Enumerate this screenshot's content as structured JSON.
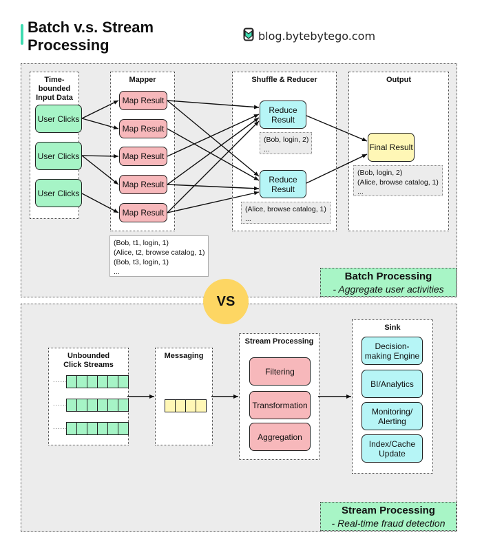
{
  "header": {
    "title_line1": "Batch v.s. Stream",
    "title_line2": "Processing",
    "accent_color": "#3ddbb0",
    "brand_icon": "bytebytego-logo-icon",
    "brand_text": "blog.bytebytego.com"
  },
  "batch": {
    "groups": {
      "input": "Time-bounded\nInput Data",
      "mapper": "Mapper",
      "reducer": "Shuffle & Reducer",
      "output": "Output"
    },
    "inputs": [
      "User Clicks",
      "User Clicks",
      "User Clicks"
    ],
    "map_results": [
      "Map Result",
      "Map Result",
      "Map Result",
      "Map Result",
      "Map Result"
    ],
    "reduce_results": [
      "Reduce\nResult",
      "Reduce\nResult"
    ],
    "final_result": "Final Result",
    "mapper_note": "(Bob, t1, login, 1)\n(Alice, t2, browse catalog, 1)\n(Bob, t3, login, 1)\n...",
    "reduce_note_1": "(Bob, login, 2)\n...",
    "reduce_note_2": "(Alice, browse catalog, 1)\n...",
    "output_note": "(Bob, login, 2)\n(Alice, browse catalog, 1)\n...",
    "edges": {
      "input_to_map": [
        [
          0,
          0
        ],
        [
          0,
          1
        ],
        [
          1,
          2
        ],
        [
          1,
          3
        ],
        [
          2,
          4
        ]
      ],
      "map_to_reduce": [
        [
          0,
          0
        ],
        [
          0,
          1
        ],
        [
          1,
          1
        ],
        [
          2,
          0
        ],
        [
          3,
          0
        ],
        [
          3,
          1
        ],
        [
          4,
          0
        ],
        [
          4,
          1
        ]
      ]
    },
    "label_title": "Batch Processing",
    "label_subtitle": "- Aggregate user activities"
  },
  "vs_label": "VS",
  "stream": {
    "groups": {
      "source": "Unbounded\nClick Streams",
      "messaging": "Messaging",
      "processing": "Stream Processing",
      "sink": "Sink"
    },
    "stream_ellipsis": "......",
    "stream_count": 3,
    "stream_cells": 6,
    "message_cells": 4,
    "processing_steps": [
      "Filtering",
      "Transformation",
      "Aggregation"
    ],
    "sinks": [
      "Decision-\nmaking Engine",
      "BI/Analytics",
      "Monitoring/\nAlerting",
      "Index/Cache\nUpdate"
    ],
    "label_title": "Stream Processing",
    "label_subtitle": "- Real-time fraud detection"
  },
  "colors": {
    "input_green": "#a6f4c6",
    "map_pink": "#f7b8bb",
    "reduce_cyan": "#b6f5f6",
    "final_yellow": "#fff7b6",
    "vs_yellow": "#fdd663",
    "label_green": "#a8f5c6",
    "panel_gray": "#ececec"
  }
}
